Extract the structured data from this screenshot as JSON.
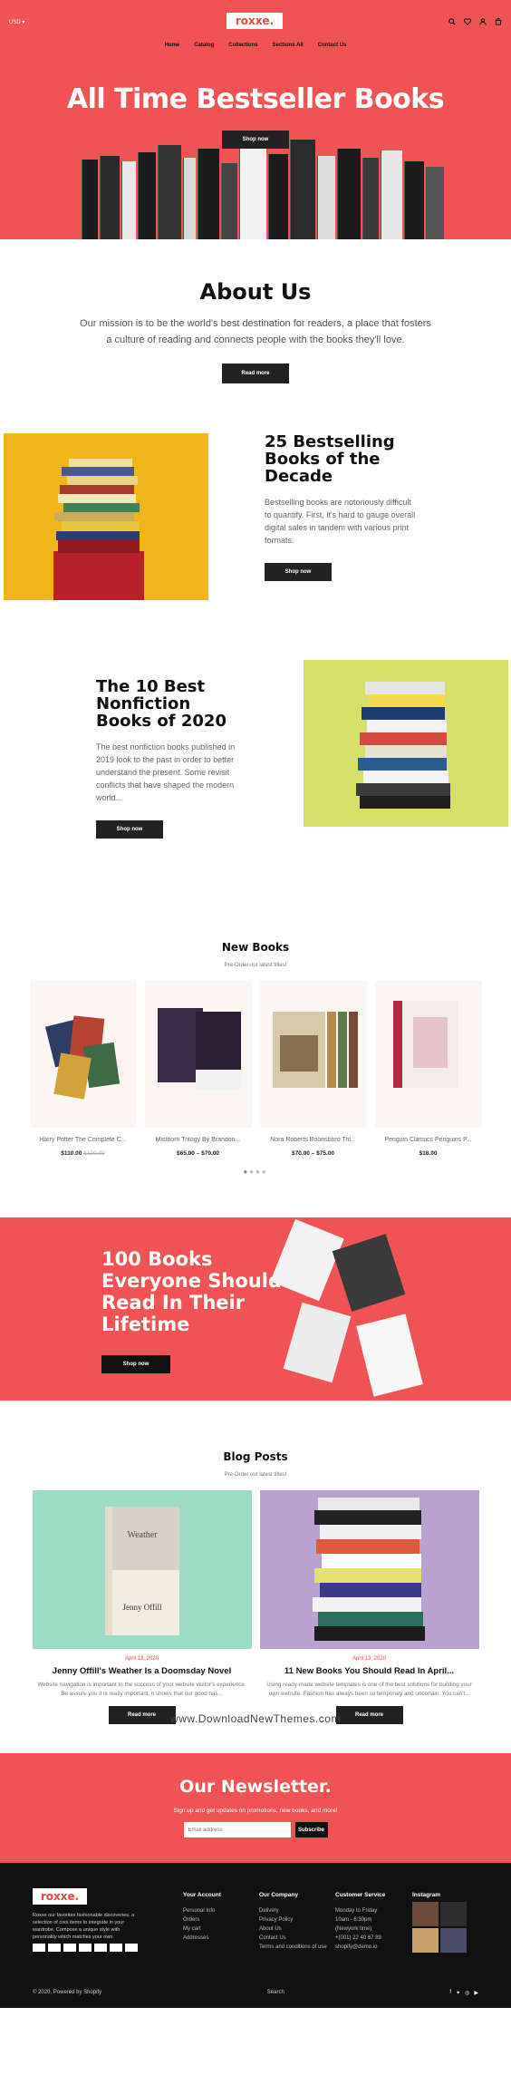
{
  "header": {
    "currency": "USD ▾",
    "logo": "roxxe.",
    "nav": [
      "Home",
      "Catalog",
      "Collections",
      "Sections All",
      "Contact Us"
    ],
    "icons": [
      "search-icon",
      "heart-icon",
      "user-icon",
      "cart-icon"
    ]
  },
  "hero": {
    "title": "All Time Bestseller Books",
    "button": "Shop now"
  },
  "about": {
    "title": "About Us",
    "text": "Our mission is to be the world's best destination for readers, a place that fosters a culture of reading and connects people with the books they'll love.",
    "button": "Read more"
  },
  "feature1": {
    "title": "25 Bestselling Books of the Decade",
    "text": "Bestselling books are notoriously difficult to quantify. First, it's hard to gauge overall digital sales in tandem with various print formats.",
    "button": "Shop now"
  },
  "feature2": {
    "title": "The 10 Best Nonfiction Books of 2020",
    "text": "The best nonfiction books published in 2019 look to the past in order to better understand the present. Some revisit conflicts that have shaped the modern world...",
    "button": "Shop now"
  },
  "new_books": {
    "title": "New Books",
    "subtitle": "Pre-Order our latest titles!",
    "products": [
      {
        "name": "Harry Potter The Complete C...",
        "price": "$110.00",
        "old_price": "$120.00"
      },
      {
        "name": "Mistborn Trilogy By Brandon...",
        "price": "$65.00 – $70.00",
        "old_price": ""
      },
      {
        "name": "Nora Roberts Boonsboro Tril...",
        "price": "$70.00 – $75.00",
        "old_price": ""
      },
      {
        "name": "Penguin Classics Penguins P...",
        "price": "$18.00",
        "old_price": ""
      }
    ]
  },
  "promo": {
    "title": "100 Books Everyone Should Read In Their Lifetime",
    "button": "Shop now"
  },
  "blog": {
    "title": "Blog Posts",
    "subtitle": "Pre-Order our latest titles!",
    "posts": [
      {
        "date": "April 13, 2020",
        "title": "Jenny Offill's Weather Is a Doomsday Novel",
        "excerpt": "Website navigation is important to the success of your website visitor's experience. Be assure you it is really important, it shows that our good has...",
        "button": "Read more",
        "book_title": "Weather",
        "book_author": "Jenny Offill"
      },
      {
        "date": "April 13, 2020",
        "title": "11 New Books You Should Read In April...",
        "excerpt": "Using ready-made website templates is one of the best solutions for building your own website. Fashion has always been so temporary and uncertain. You can't...",
        "button": "Read more"
      }
    ]
  },
  "watermark": "www.DownloadNewThemes.com",
  "newsletter": {
    "title": "Our Newsletter.",
    "text": "Sign up and get updates on promotions, new books, and more!",
    "placeholder": "Email address",
    "button": "Subscribe"
  },
  "footer": {
    "logo": "roxxe.",
    "about": "Roxxe our favorites fashionable discoveries, a selection of cool items to integrate in your wardrobe. Compose a unique style with personality which matches your own.",
    "columns": [
      {
        "title": "Your Account",
        "items": [
          "Personal Info",
          "Orders",
          "My cart",
          "Addresses"
        ]
      },
      {
        "title": "Our Company",
        "items": [
          "Delivery",
          "Privacy Policy",
          "About Us",
          "Contact Us",
          "Terms and conditions of use"
        ]
      },
      {
        "title": "Customer Service",
        "items": [
          "Monday to Friday",
          "10am - 6:30pm",
          "(Newyork time)",
          "+(001) 22 40 67 89",
          "shopify@demo.io"
        ]
      }
    ],
    "instagram_title": "Instagram",
    "copyright": "© 2020, Powered by Shopify",
    "search_link": "Search",
    "social_icons": [
      "facebook-icon",
      "twitter-icon",
      "instagram-icon",
      "youtube-icon"
    ]
  },
  "colors": {
    "accent": "#f05353",
    "dark": "#222222",
    "yellow": "#f1b51c",
    "lime": "#d7df6a"
  }
}
